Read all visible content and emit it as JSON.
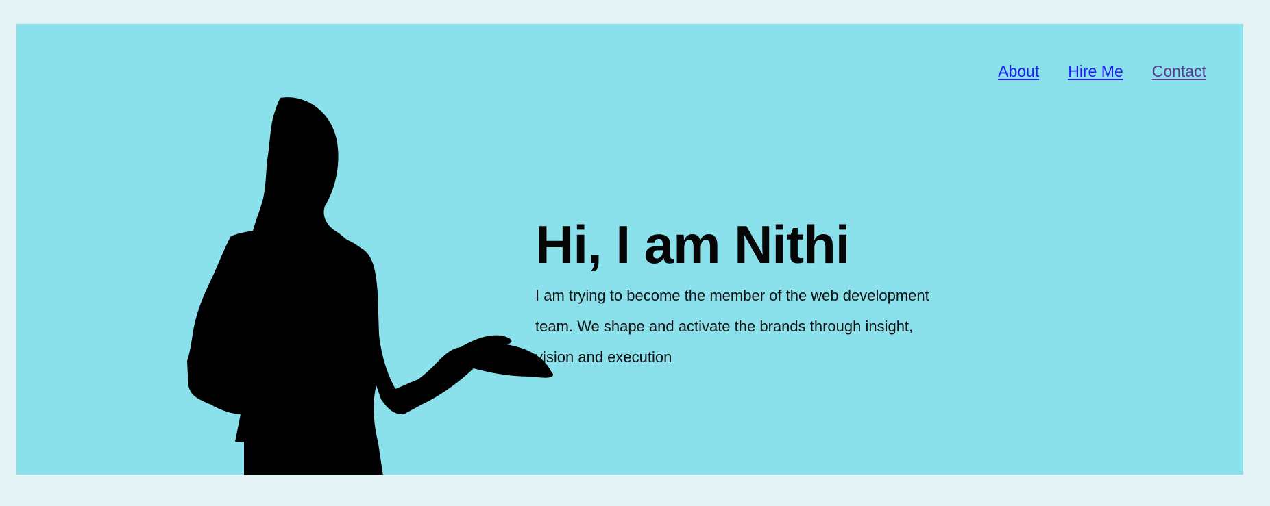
{
  "nav": {
    "items": [
      {
        "label": "About",
        "state": "default"
      },
      {
        "label": "Hire Me",
        "state": "default"
      },
      {
        "label": "Contact",
        "state": "visited"
      }
    ]
  },
  "hero": {
    "title": "Hi, I am Nithi",
    "subtitle": "I am trying to become the member of the web development team. We shape and activate the brands through insight, vision and execution",
    "image_name": "woman-silhouette"
  },
  "colors": {
    "page_background": "#e4f3f5",
    "hero_background": "#8ae1eb",
    "link": "#1e1ff0",
    "visited_link": "#5a3b92",
    "text": "#111111",
    "silhouette": "#000000"
  }
}
